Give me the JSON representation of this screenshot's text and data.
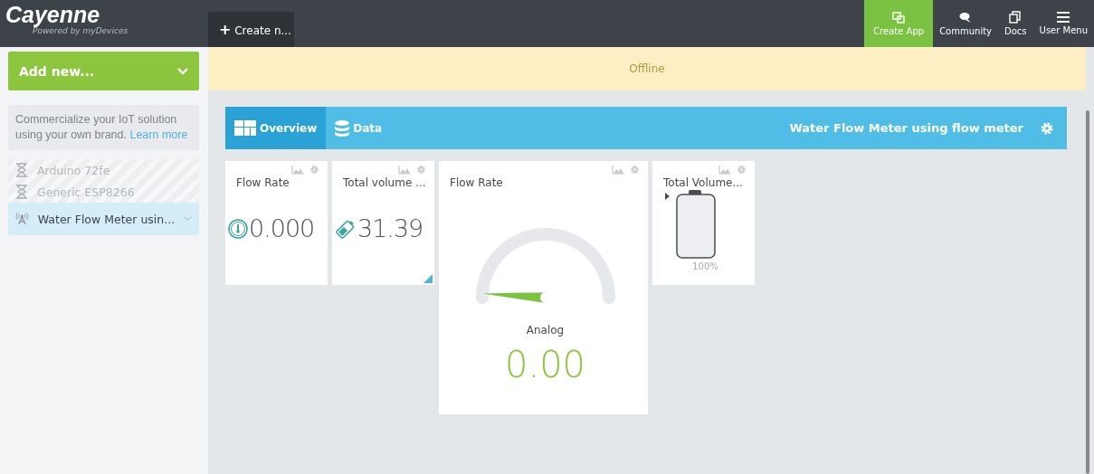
{
  "logo": {
    "name": "Cayenne",
    "tagline": "Powered by myDevices"
  },
  "create_button": {
    "icon": "+",
    "label": "Create n..."
  },
  "top_nav": [
    {
      "label": "Create App",
      "selected": true,
      "kind": "app"
    },
    {
      "label": "Community",
      "selected": false,
      "kind": "chat"
    },
    {
      "label": "Docs",
      "selected": false,
      "kind": "docs"
    },
    {
      "label": "User Menu",
      "selected": false,
      "kind": "menu"
    }
  ],
  "sidebar": {
    "add_button": "Add new...",
    "promo": {
      "text": "Commercialize your IoT solution using your own brand.",
      "link": "Learn more"
    },
    "devices": [
      {
        "name": "Arduino 72fe",
        "offline": true,
        "selected": false
      },
      {
        "name": "Generic ESP8266",
        "offline": true,
        "selected": false
      },
      {
        "name": "Water Flow Meter usin...",
        "offline": false,
        "selected": true
      }
    ]
  },
  "status_banner": "Offline",
  "tabs": [
    {
      "label": "Overview",
      "selected": true,
      "kind": "overview"
    },
    {
      "label": "Data",
      "selected": false,
      "kind": "data"
    }
  ],
  "device_title": "Water Flow Meter using flow meter",
  "widgets": [
    {
      "kind": "value",
      "title": "Flow Rate",
      "value": "0.000"
    },
    {
      "kind": "value",
      "title": "Total volume ...",
      "value": "31.39"
    },
    {
      "kind": "gauge",
      "title": "Flow Rate",
      "label": "Analog",
      "value": "0.00"
    },
    {
      "kind": "tank",
      "title": "Total Volume...",
      "reading": "100%"
    }
  ]
}
